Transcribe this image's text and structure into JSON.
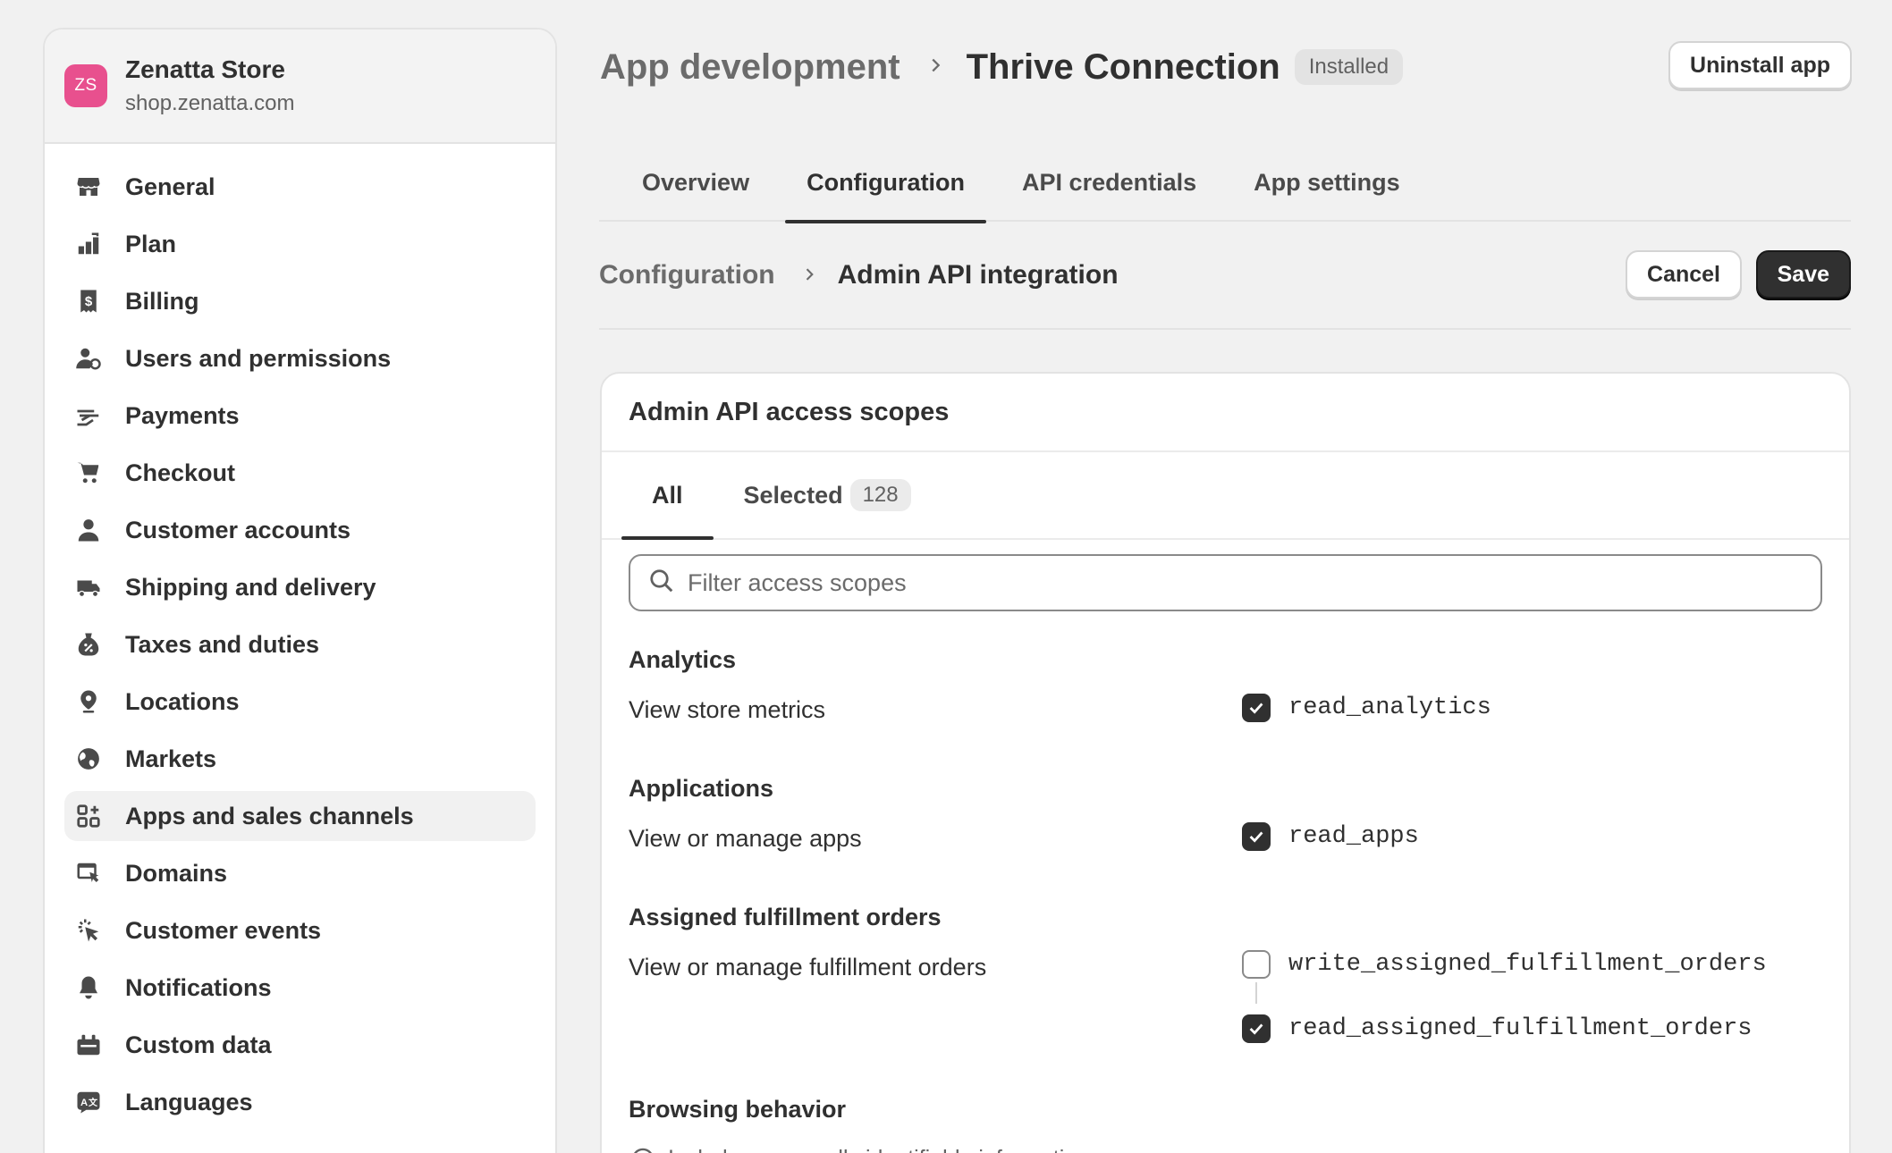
{
  "store": {
    "initials": "ZS",
    "name": "Zenatta Store",
    "domain": "shop.zenatta.com",
    "avatar_color": "#e8508e"
  },
  "sidebar": {
    "items": [
      {
        "label": "General",
        "icon": "store-icon"
      },
      {
        "label": "Plan",
        "icon": "plan-icon"
      },
      {
        "label": "Billing",
        "icon": "billing-icon"
      },
      {
        "label": "Users and permissions",
        "icon": "users-icon"
      },
      {
        "label": "Payments",
        "icon": "payments-icon"
      },
      {
        "label": "Checkout",
        "icon": "cart-icon"
      },
      {
        "label": "Customer accounts",
        "icon": "person-icon"
      },
      {
        "label": "Shipping and delivery",
        "icon": "truck-icon"
      },
      {
        "label": "Taxes and duties",
        "icon": "tax-icon"
      },
      {
        "label": "Locations",
        "icon": "location-icon"
      },
      {
        "label": "Markets",
        "icon": "globe-icon"
      },
      {
        "label": "Apps and sales channels",
        "icon": "apps-icon",
        "active": true
      },
      {
        "label": "Domains",
        "icon": "domains-icon"
      },
      {
        "label": "Customer events",
        "icon": "cursor-click-icon"
      },
      {
        "label": "Notifications",
        "icon": "bell-icon"
      },
      {
        "label": "Custom data",
        "icon": "custom-data-icon"
      },
      {
        "label": "Languages",
        "icon": "language-icon"
      }
    ]
  },
  "header": {
    "parent": "App development",
    "current": "Thrive Connection",
    "status_badge": "Installed",
    "uninstall_label": "Uninstall app"
  },
  "tabs": [
    {
      "label": "Overview"
    },
    {
      "label": "Configuration",
      "active": true
    },
    {
      "label": "API credentials"
    },
    {
      "label": "App settings"
    }
  ],
  "subheader": {
    "parent": "Configuration",
    "current": "Admin API integration",
    "cancel_label": "Cancel",
    "save_label": "Save"
  },
  "scopes_card": {
    "title": "Admin API access scopes",
    "tabs": [
      {
        "label": "All",
        "active": true
      },
      {
        "label": "Selected",
        "count": "128"
      }
    ],
    "search_placeholder": "Filter access scopes",
    "sections": [
      {
        "title": "Analytics",
        "description": "View store metrics",
        "scopes": [
          {
            "code": "read_analytics",
            "checked": true
          }
        ]
      },
      {
        "title": "Applications",
        "description": "View or manage apps",
        "scopes": [
          {
            "code": "read_apps",
            "checked": true
          }
        ]
      },
      {
        "title": "Assigned fulfillment orders",
        "description": "View or manage fulfillment orders",
        "scopes": [
          {
            "code": "write_assigned_fulfillment_orders",
            "checked": false
          },
          {
            "code": "read_assigned_fulfillment_orders",
            "checked": true
          }
        ]
      },
      {
        "title": "Browsing behavior",
        "note": "Includes personally identifiable information"
      }
    ]
  },
  "colors": {
    "primary_button": "#303030",
    "page_bg": "#f1f1f1",
    "card_bg": "#ffffff"
  }
}
